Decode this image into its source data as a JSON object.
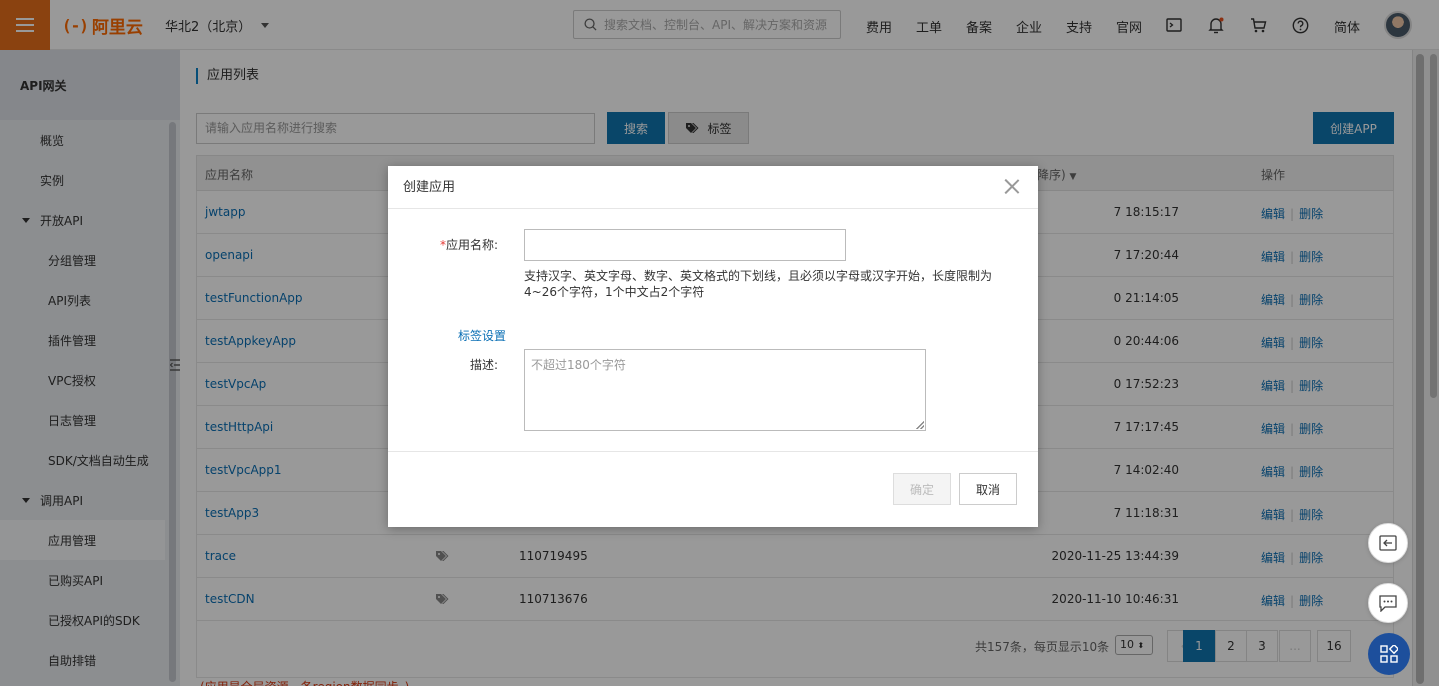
{
  "topbar": {
    "brand": "阿里云",
    "brand_mark": "(-)",
    "region": "华北2（北京）",
    "search_placeholder": "搜索文档、控制台、API、解决方案和资源",
    "nav": [
      "费用",
      "工单",
      "备案",
      "企业",
      "支持",
      "官网"
    ],
    "lang": "简体",
    "icons": [
      "terminal-icon",
      "bell-icon",
      "cart-icon",
      "help-icon"
    ]
  },
  "sidebar": {
    "title": "API网关",
    "items": [
      {
        "label": "概览",
        "level": "l1"
      },
      {
        "label": "实例",
        "level": "l1"
      },
      {
        "label": "开放API",
        "level": "grp"
      },
      {
        "label": "分组管理",
        "level": "l2"
      },
      {
        "label": "API列表",
        "level": "l2"
      },
      {
        "label": "插件管理",
        "level": "l2"
      },
      {
        "label": "VPC授权",
        "level": "l2"
      },
      {
        "label": "日志管理",
        "level": "l2"
      },
      {
        "label": "SDK/文档自动生成",
        "level": "l2"
      },
      {
        "label": "调用API",
        "level": "grp"
      },
      {
        "label": "应用管理",
        "level": "l2",
        "active": true
      },
      {
        "label": "已购买API",
        "level": "l2"
      },
      {
        "label": "已授权API的SDK",
        "level": "l2"
      },
      {
        "label": "自助排错",
        "level": "l2"
      }
    ]
  },
  "main": {
    "title": "应用列表",
    "filter_placeholder": "请输入应用名称进行搜索",
    "search_btn": "搜索",
    "tag_btn": "标签",
    "create_btn": "创建APP",
    "columns": {
      "name": "应用名称",
      "time": "降序)",
      "ops": "操作"
    },
    "edit": "编辑",
    "delete": "删除",
    "rows": [
      {
        "name": "jwtapp",
        "id": "",
        "time": "7 18:15:17"
      },
      {
        "name": "openapi",
        "id": "",
        "time": "7 17:20:44"
      },
      {
        "name": "testFunctionApp",
        "id": "",
        "time": "0 21:14:05"
      },
      {
        "name": "testAppkeyApp",
        "id": "",
        "time": "0 20:44:06"
      },
      {
        "name": "testVpcAp",
        "id": "",
        "time": "0 17:52:23"
      },
      {
        "name": "testHttpApi",
        "id": "",
        "time": "7 17:17:45"
      },
      {
        "name": "testVpcApp1",
        "id": "",
        "time": "7 14:02:40"
      },
      {
        "name": "testApp3",
        "id": "",
        "time": "7 11:18:31"
      },
      {
        "name": "trace",
        "id": "110719495",
        "time": "2020-11-25 13:44:39"
      },
      {
        "name": "testCDN",
        "id": "110713676",
        "time": "2020-11-10 10:46:31"
      }
    ],
    "pager": {
      "info": "共157条，每页显示10条",
      "size": "10",
      "prev": "‹",
      "pages": [
        "1",
        "2",
        "3",
        "...",
        "16"
      ],
      "current": "1"
    },
    "footnote": "(应用是全局资源，各region数据同步。)"
  },
  "modal": {
    "title": "创建应用",
    "name_label": "应用名称:",
    "required_mark": "*",
    "name_hint": "支持汉字、英文字母、数字、英文格式的下划线，且必须以字母或汉字开始，长度限制为4~26个字符，1个中文占2个字符",
    "tag_link": "标签设置",
    "desc_label": "描述:",
    "desc_placeholder": "不超过180个字符",
    "ok": "确定",
    "cancel": "取消"
  },
  "colors": {
    "brand": "#ff6a00",
    "primary": "#0f75b0",
    "link": "#0a6fb5"
  }
}
